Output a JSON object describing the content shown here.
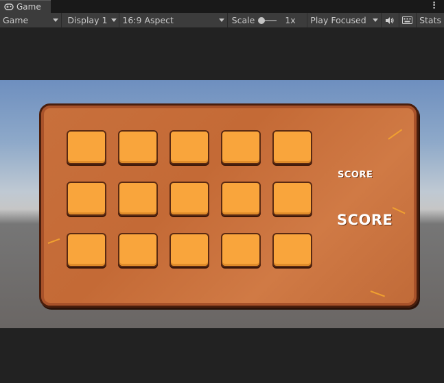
{
  "tab": {
    "label": "Game",
    "icon": "gamepad-icon"
  },
  "toolbar": {
    "view_mode": "Game",
    "display": "Display 1",
    "aspect": "16:9 Aspect",
    "scale_label": "Scale",
    "scale_value": "1x",
    "play_mode": "Play Focused",
    "stats_label": "Stats"
  },
  "game": {
    "tiles": {
      "rows": 3,
      "cols": 5
    },
    "score_label_small": "SCORE",
    "score_label_large": "SCORE"
  },
  "colors": {
    "board": "#c8703c",
    "tile": "#f9a53c",
    "sky_top": "#6e8fbf",
    "ground": "#6a6664"
  }
}
